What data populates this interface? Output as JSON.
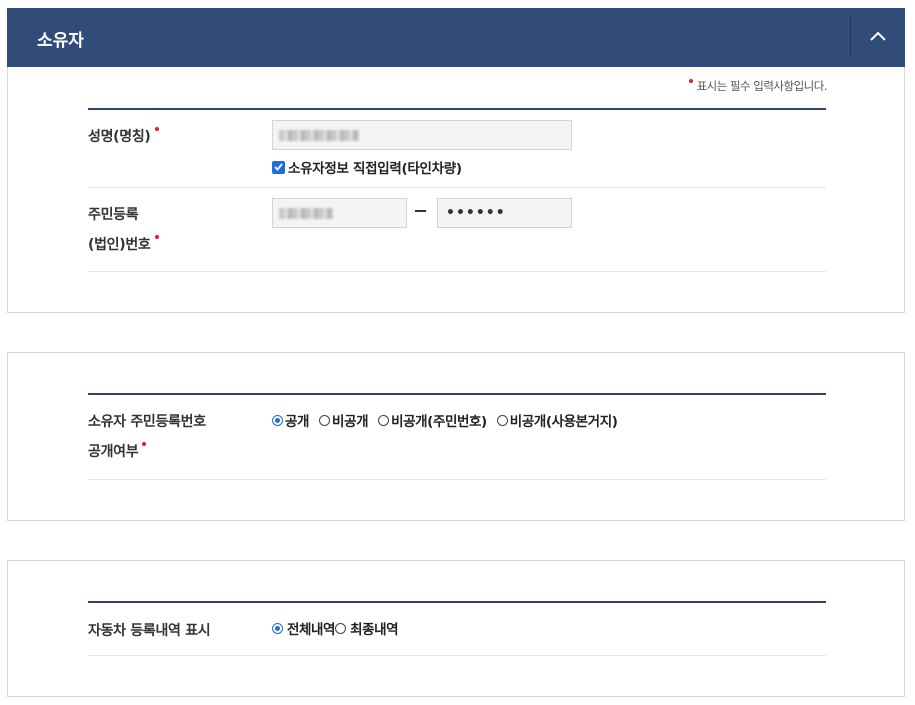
{
  "section": {
    "title": "소유자",
    "required_note": "표시는 필수 입력사항입니다."
  },
  "owner_name": {
    "label": "성명(명칭)",
    "direct_input_label": "소유자정보 직접입력(타인차량)",
    "direct_input_checked": true
  },
  "resident_number": {
    "label_line1": "주민등록",
    "label_line2": "(법인)번호",
    "masked_value": "••••••"
  },
  "disclosure": {
    "label_line1": "소유자 주민등록번호",
    "label_line2": "공개여부",
    "options": [
      "공개",
      "비공개",
      "비공개(주민번호)",
      "비공개(사용본거지)"
    ],
    "selected": "공개"
  },
  "registration_history": {
    "label": "자동차 등록내역 표시",
    "options": [
      "전체내역",
      "최종내역"
    ],
    "selected": "전체내역"
  },
  "colors": {
    "header_bg": "#324c7a",
    "required_dot": "#e02020",
    "accent": "#1f6fd6"
  }
}
